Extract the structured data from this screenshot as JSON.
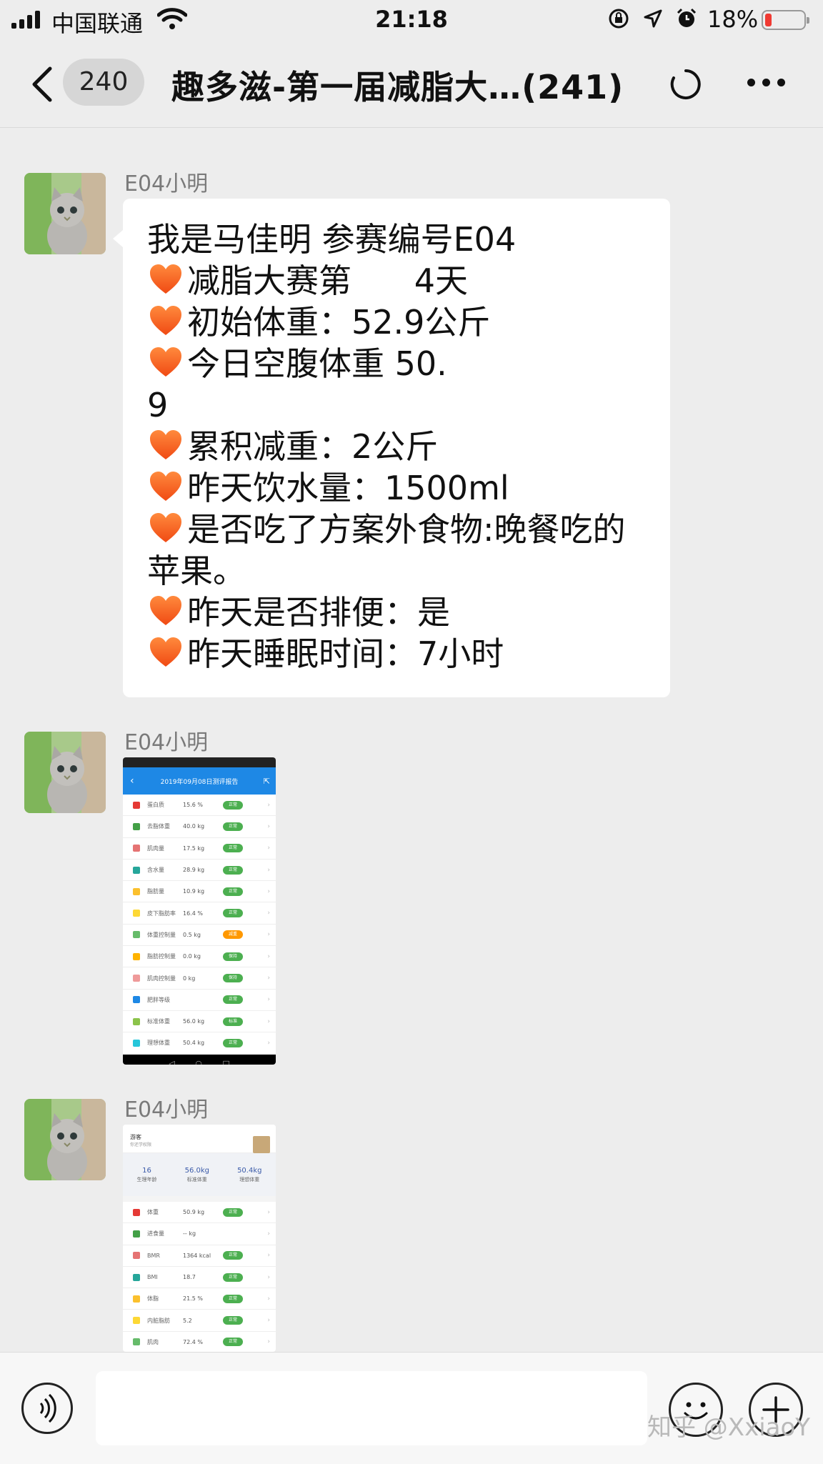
{
  "status_bar": {
    "carrier": "中国联通",
    "time": "21:18",
    "battery_percent": "18%",
    "battery_level": 0.18,
    "icons": [
      "signal-icon",
      "wifi-icon",
      "rotation-lock-icon",
      "location-icon",
      "alarm-icon",
      "battery-icon"
    ]
  },
  "nav": {
    "unread_count": "240",
    "title": "趣多滋-第一届减脂大…(241)"
  },
  "messages": [
    {
      "sender": "E04小明",
      "type": "text",
      "lines": [
        {
          "heart": false,
          "text": "我是马佳明 参赛编号E04"
        },
        {
          "heart": true,
          "text": "减脂大赛第      4天"
        },
        {
          "heart": true,
          "text": "初始体重：52.9公斤"
        },
        {
          "heart": true,
          "text": "今日空腹体重 50."
        },
        {
          "heart": false,
          "text": "9"
        },
        {
          "heart": true,
          "text": "累积减重：2公斤"
        },
        {
          "heart": true,
          "text": "昨天饮水量：1500ml"
        },
        {
          "heart": true,
          "text": "是否吃了方案外食物:晚餐吃的"
        },
        {
          "heart": false,
          "text": "苹果。"
        },
        {
          "heart": true,
          "text": "昨天是否排便：是"
        },
        {
          "heart": true,
          "text": "昨天睡眠时间：7小时"
        }
      ]
    },
    {
      "sender": "E04小明",
      "type": "image",
      "header": "2019年09月08日测评报告",
      "rows": [
        {
          "name": "蛋白质",
          "value": "15.6 %",
          "status": "正常",
          "color": "#4caf50"
        },
        {
          "name": "去脂体重",
          "value": "40.0 kg",
          "status": "正常",
          "color": "#4caf50"
        },
        {
          "name": "肌肉量",
          "value": "17.5 kg",
          "status": "正常",
          "color": "#4caf50"
        },
        {
          "name": "含水量",
          "value": "28.9 kg",
          "status": "正常",
          "color": "#4caf50"
        },
        {
          "name": "脂肪量",
          "value": "10.9 kg",
          "status": "正常",
          "color": "#4caf50"
        },
        {
          "name": "皮下脂肪率",
          "value": "16.4 %",
          "status": "正常",
          "color": "#4caf50"
        },
        {
          "name": "体重控制量",
          "value": "0.5 kg",
          "status": "减重",
          "color": "#ff9800"
        },
        {
          "name": "脂肪控制量",
          "value": "0.0 kg",
          "status": "保持",
          "color": "#4caf50"
        },
        {
          "name": "肌肉控制量",
          "value": "0 kg",
          "status": "保持",
          "color": "#4caf50"
        },
        {
          "name": "肥胖等级",
          "value": "",
          "status": "正常",
          "color": "#4caf50"
        },
        {
          "name": "标准体重",
          "value": "56.0 kg",
          "status": "标准",
          "color": "#4caf50"
        },
        {
          "name": "理想体重",
          "value": "50.4 kg",
          "status": "正常",
          "color": "#4caf50"
        }
      ]
    },
    {
      "sender": "E04小明",
      "type": "image",
      "card_title": "游客",
      "card_sub": "你还学权限",
      "stats": [
        {
          "value": "16",
          "label": "生理年龄"
        },
        {
          "value": "56.0kg",
          "label": "标准体重"
        },
        {
          "value": "50.4kg",
          "label": "理想体重"
        }
      ],
      "rows": [
        {
          "name": "体重",
          "value": "50.9 kg",
          "status": "正常",
          "color": "#4caf50"
        },
        {
          "name": "进食量",
          "value": "-- kg",
          "status": "",
          "color": ""
        },
        {
          "name": "BMR",
          "value": "1364 kcal",
          "status": "正常",
          "color": "#4caf50"
        },
        {
          "name": "BMI",
          "value": "18.7",
          "status": "正常",
          "color": "#4caf50"
        },
        {
          "name": "体脂",
          "value": "21.5 %",
          "status": "正常",
          "color": "#4caf50"
        },
        {
          "name": "内脏脂肪",
          "value": "5.2",
          "status": "正常",
          "color": "#4caf50"
        },
        {
          "name": "肌肉",
          "value": "72.4 %",
          "status": "正常",
          "color": "#4caf50"
        }
      ]
    }
  ],
  "input": {
    "placeholder": ""
  },
  "watermark": "知乎 @XxiaoY"
}
